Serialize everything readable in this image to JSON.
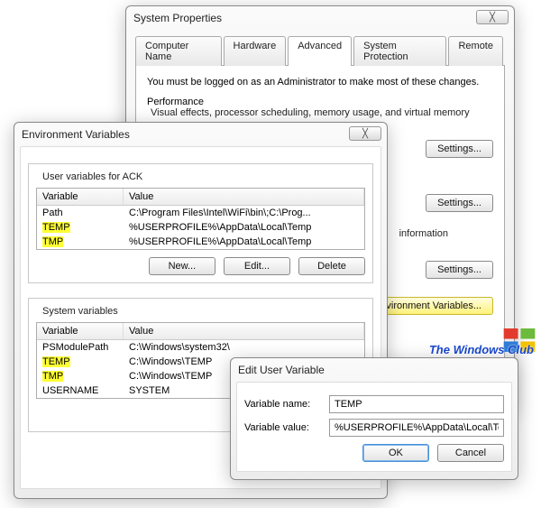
{
  "sysprop": {
    "title": "System Properties",
    "tabs": {
      "computer": "Computer Name",
      "hardware": "Hardware",
      "advanced": "Advanced",
      "protection": "System Protection",
      "remote": "Remote"
    },
    "intro": "You must be logged on as an Administrator to make most of these changes.",
    "perf": {
      "title": "Performance",
      "desc": "Visual effects, processor scheduling, memory usage, and virtual memory",
      "btn": "Settings..."
    },
    "profiles": {
      "btn": "Settings..."
    },
    "recovery": {
      "desc_tail": "information",
      "btn": "Settings..."
    },
    "envbtn": "Environment Variables...",
    "closeGlyph": "╳"
  },
  "env": {
    "title": "Environment Variables",
    "closeGlyph": "╳",
    "userGroupTitle": "User variables for ACK",
    "sysGroupTitle": "System variables",
    "columns": {
      "var": "Variable",
      "val": "Value"
    },
    "userVars": [
      {
        "name": "Path",
        "value": "C:\\Program Files\\Intel\\WiFi\\bin\\;C:\\Prog...",
        "hl": false
      },
      {
        "name": "TEMP",
        "value": "%USERPROFILE%\\AppData\\Local\\Temp",
        "hl": true
      },
      {
        "name": "TMP",
        "value": "%USERPROFILE%\\AppData\\Local\\Temp",
        "hl": true
      }
    ],
    "sysVars": [
      {
        "name": "PSModulePath",
        "value": "C:\\Windows\\system32\\",
        "hl": false
      },
      {
        "name": "TEMP",
        "value": "C:\\Windows\\TEMP",
        "hl": true
      },
      {
        "name": "TMP",
        "value": "C:\\Windows\\TEMP",
        "hl": true
      },
      {
        "name": "USERNAME",
        "value": "SYSTEM",
        "hl": false
      }
    ],
    "btns": {
      "new": "New...",
      "edit": "Edit...",
      "editShort": "Edit",
      "del": "Delete"
    }
  },
  "editdlg": {
    "title": "Edit User Variable",
    "nameLabel": "Variable name:",
    "valueLabel": "Variable value:",
    "nameValue": "TEMP",
    "valueValue": "%USERPROFILE%\\AppData\\Local\\Temp",
    "ok": "OK",
    "cancel": "Cancel"
  },
  "watermark": "The Windows Club"
}
